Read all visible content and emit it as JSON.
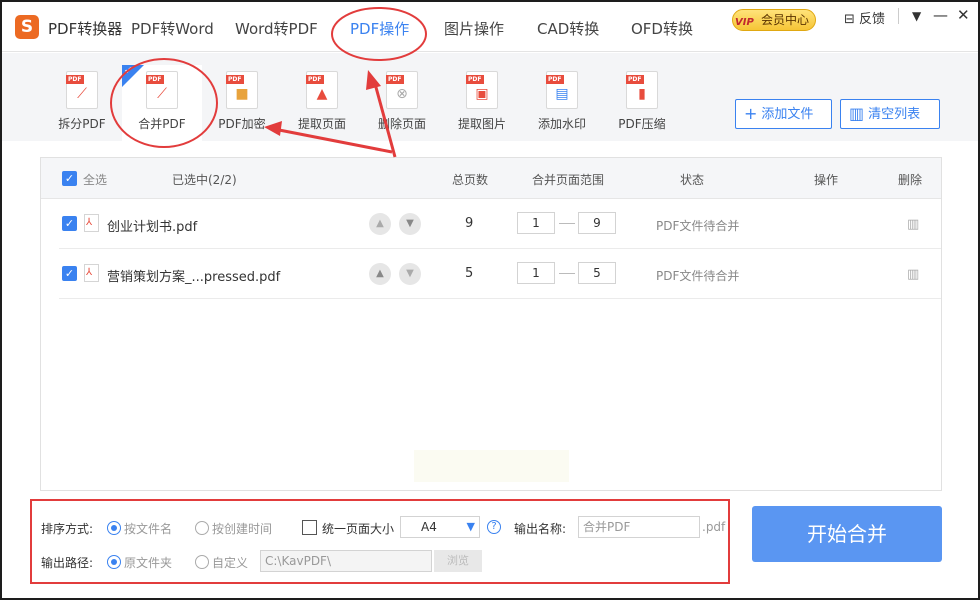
{
  "app": {
    "logo_letter": "S",
    "title": "PDF转换器"
  },
  "nav": {
    "tabs": [
      {
        "label": "PDF转Word"
      },
      {
        "label": "Word转PDF"
      },
      {
        "label": "PDF操作"
      },
      {
        "label": "图片操作"
      },
      {
        "label": "CAD转换"
      },
      {
        "label": "OFD转换"
      }
    ],
    "active_tab": "PDF操作",
    "vip_badge": "VIP",
    "vip_label": "会员中心",
    "feedback": "反馈",
    "menu_glyph": "▼",
    "minimize_glyph": "—",
    "close_glyph": "✕"
  },
  "toolbar": {
    "tools": [
      {
        "label": "拆分PDF",
        "icon": "split-pdf-icon"
      },
      {
        "label": "合并PDF",
        "icon": "merge-pdf-icon",
        "selected": true
      },
      {
        "label": "PDF加密",
        "icon": "encrypt-pdf-icon"
      },
      {
        "label": "提取页面",
        "icon": "extract-pages-icon"
      },
      {
        "label": "删除页面",
        "icon": "delete-pages-icon"
      },
      {
        "label": "提取图片",
        "icon": "extract-images-icon"
      },
      {
        "label": "添加水印",
        "icon": "watermark-icon"
      },
      {
        "label": "PDF压缩",
        "icon": "compress-pdf-icon"
      }
    ],
    "add_file": "添加文件",
    "clear_list": "清空列表"
  },
  "table": {
    "headers": {
      "select_all": "全选",
      "selected_count": "已选中(2/2)",
      "total_pages": "总页数",
      "page_range": "合并页面范围",
      "status": "状态",
      "actions": "操作",
      "delete": "删除"
    },
    "rows": [
      {
        "name": "创业计划书.pdf",
        "pages": "9",
        "range_start": "1",
        "range_end": "9",
        "status": "PDF文件待合并"
      },
      {
        "name": "营销策划方案_...pressed.pdf",
        "pages": "5",
        "range_start": "1",
        "range_end": "5",
        "status": "PDF文件待合并"
      }
    ]
  },
  "settings": {
    "sort_label": "排序方式:",
    "sort_by_name": "按文件名",
    "sort_by_time": "按创建时间",
    "sort_selected": "按文件名",
    "uniform_size": "统一页面大小",
    "page_size": "A4",
    "output_name_label": "输出名称:",
    "output_name_placeholder": "合并PDF",
    "output_ext": ".pdf",
    "output_path_label": "输出路径:",
    "path_original": "原文件夹",
    "path_custom": "自定义",
    "path_selected": "原文件夹",
    "path_value": "C:\\KavPDF\\",
    "browse": "浏览"
  },
  "start_button": "开始合并",
  "colors": {
    "accent": "#3a82f0",
    "annotation": "#e23c3c",
    "start": "#5a96f2"
  }
}
